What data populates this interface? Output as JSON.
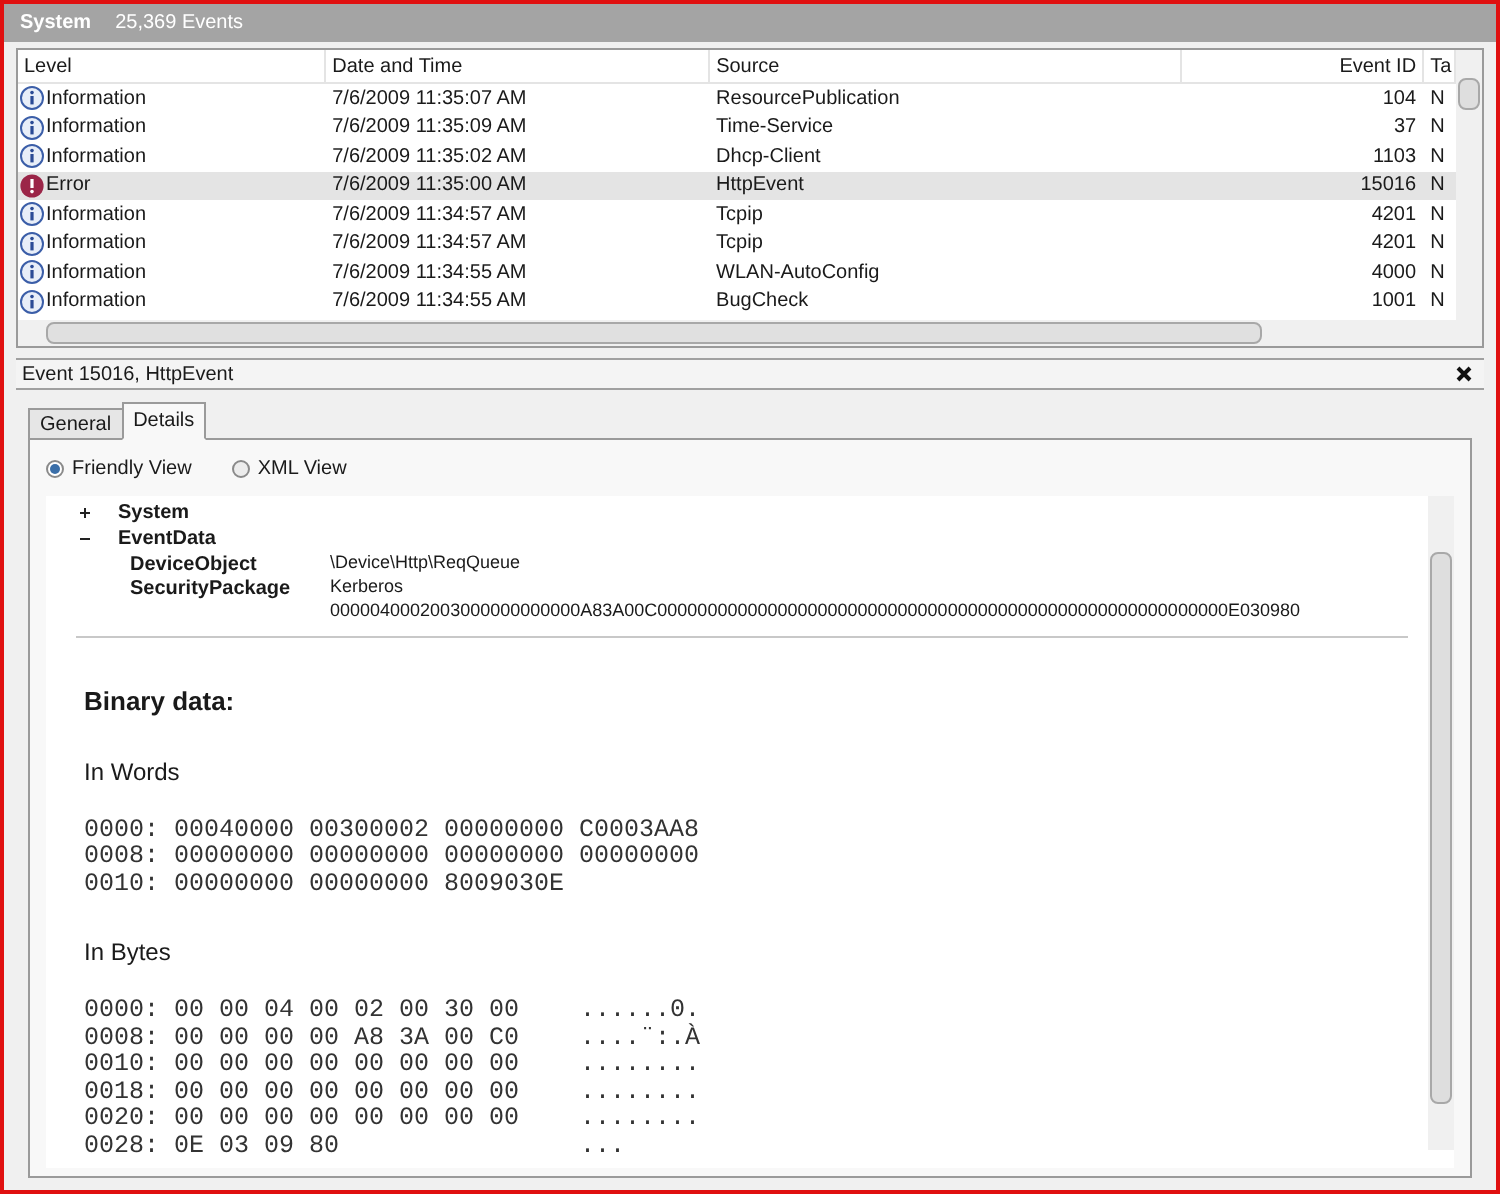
{
  "log_header": {
    "title": "System",
    "count": "25,369 Events"
  },
  "table": {
    "columns": [
      "Level",
      "Date and Time",
      "Source",
      "Event ID",
      "Ta"
    ],
    "rows": [
      {
        "kind": "information",
        "level": "Information",
        "date": "7/6/2009 11:35:07 AM",
        "source": "ResourcePublication",
        "event_id": "104",
        "task": "N",
        "selected": false
      },
      {
        "kind": "information",
        "level": "Information",
        "date": "7/6/2009 11:35:09 AM",
        "source": "Time-Service",
        "event_id": "37",
        "task": "N",
        "selected": false
      },
      {
        "kind": "information",
        "level": "Information",
        "date": "7/6/2009 11:35:02 AM",
        "source": "Dhcp-Client",
        "event_id": "1103",
        "task": "N",
        "selected": false
      },
      {
        "kind": "error",
        "level": "Error",
        "date": "7/6/2009 11:35:00 AM",
        "source": "HttpEvent",
        "event_id": "15016",
        "task": "N",
        "selected": true
      },
      {
        "kind": "information",
        "level": "Information",
        "date": "7/6/2009 11:34:57 AM",
        "source": "Tcpip",
        "event_id": "4201",
        "task": "N",
        "selected": false
      },
      {
        "kind": "information",
        "level": "Information",
        "date": "7/6/2009 11:34:57 AM",
        "source": "Tcpip",
        "event_id": "4201",
        "task": "N",
        "selected": false
      },
      {
        "kind": "information",
        "level": "Information",
        "date": "7/6/2009 11:34:55 AM",
        "source": "WLAN-AutoConfig",
        "event_id": "4000",
        "task": "N",
        "selected": false
      },
      {
        "kind": "information",
        "level": "Information",
        "date": "7/6/2009 11:34:55 AM",
        "source": "BugCheck",
        "event_id": "1001",
        "task": "N",
        "selected": false
      }
    ]
  },
  "detail": {
    "title": "Event 15016, HttpEvent",
    "tabs": [
      {
        "label": "General",
        "selected": false
      },
      {
        "label": "Details",
        "selected": true
      }
    ],
    "views": [
      {
        "label": "Friendly View",
        "selected": true
      },
      {
        "label": "XML View",
        "selected": false
      }
    ],
    "tree": [
      {
        "name": "System",
        "expanded": false
      },
      {
        "name": "EventData",
        "expanded": true,
        "children": [
          {
            "name": "DeviceObject",
            "value": "\\Device\\Http\\ReqQueue"
          },
          {
            "name": "SecurityPackage",
            "value": "Kerberos"
          },
          {
            "value": "0000040002003000000000000A83A00C000000000000000000000000000000000000000000000000000000000E030980"
          }
        ]
      }
    ],
    "binary": {
      "title": "Binary data:",
      "words_title": "In Words",
      "words": [
        "0000: 00040000 00300002 00000000 C0003AA8",
        "0008: 00000000 00000000 00000000 00000000",
        "0010: 00000000 00000000 8009030E"
      ],
      "bytes_title": "In Bytes",
      "bytes": [
        {
          "hex": "0000: 00 00 04 00 02 00 30 00",
          "ascii": "......0."
        },
        {
          "hex": "0008: 00 00 00 00 A8 3A 00 C0",
          "ascii": "....¨:.À"
        },
        {
          "hex": "0010: 00 00 00 00 00 00 00 00",
          "ascii": "........"
        },
        {
          "hex": "0018: 00 00 00 00 00 00 00 00",
          "ascii": "........"
        },
        {
          "hex": "0020: 00 00 00 00 00 00 00 00",
          "ascii": "........"
        },
        {
          "hex": "0028: 0E 03 09 80",
          "ascii": "..."
        }
      ]
    }
  }
}
